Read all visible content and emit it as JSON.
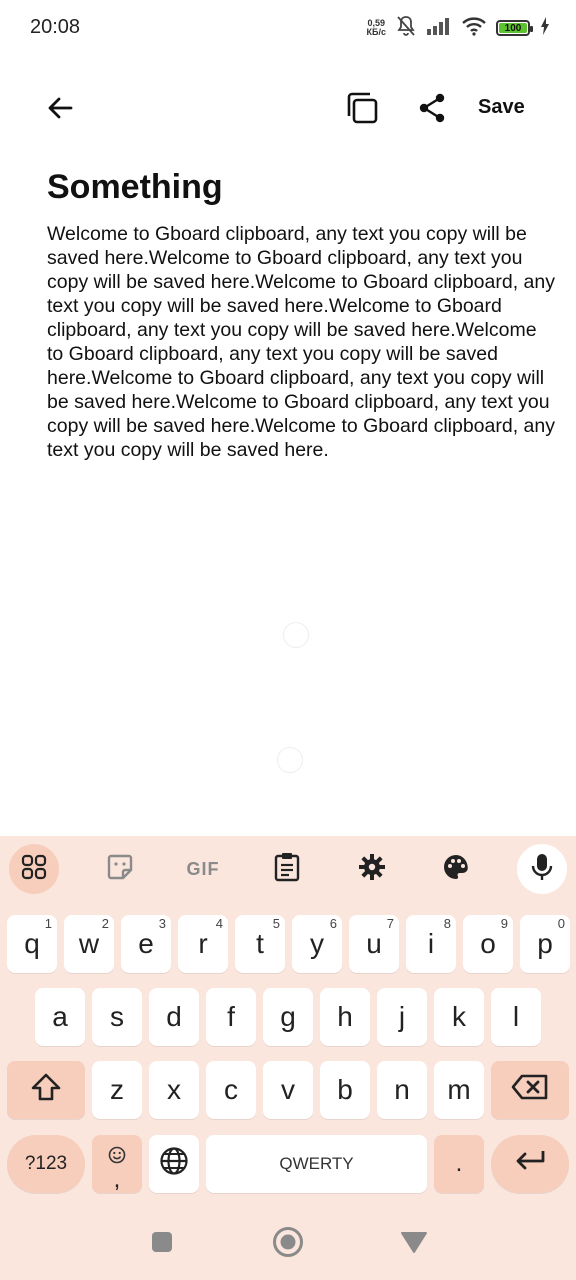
{
  "status_bar": {
    "time": "20:08",
    "net_speed_value": "0,59",
    "net_speed_unit": "КБ/с",
    "battery_level": "100",
    "icons": [
      "mute-icon",
      "signal-icon",
      "wifi-icon",
      "battery-icon",
      "charging-icon"
    ]
  },
  "app_bar": {
    "back_icon": "arrow-left-icon",
    "copy_icon": "copy-icon",
    "share_icon": "share-icon",
    "save_label": "Save"
  },
  "note": {
    "title": "Something",
    "body": "Welcome to Gboard clipboard, any text you copy will be saved here.Welcome to Gboard clipboard, any text you copy will be saved here.Welcome to Gboard clipboard, any text you copy will be saved here.Welcome to Gboard clipboard, any text you copy will be saved here.Welcome to Gboard clipboard, any text you copy will be saved here.Welcome to Gboard clipboard, any text you copy will be saved here.Welcome to Gboard clipboard, any text you copy will be saved here.Welcome to Gboard clipboard, any text you copy will be saved here."
  },
  "keyboard": {
    "toolbar": {
      "gif_label": "GIF",
      "icons": [
        "apps-grid-icon",
        "sticker-icon",
        "gif-icon",
        "clipboard-icon",
        "gear-icon",
        "palette-icon",
        "microphone-icon"
      ]
    },
    "row1": [
      {
        "label": "q",
        "hint": "1"
      },
      {
        "label": "w",
        "hint": "2"
      },
      {
        "label": "e",
        "hint": "3"
      },
      {
        "label": "r",
        "hint": "4"
      },
      {
        "label": "t",
        "hint": "5"
      },
      {
        "label": "y",
        "hint": "6"
      },
      {
        "label": "u",
        "hint": "7"
      },
      {
        "label": "i",
        "hint": "8"
      },
      {
        "label": "o",
        "hint": "9"
      },
      {
        "label": "p",
        "hint": "0"
      }
    ],
    "row2": [
      {
        "label": "a"
      },
      {
        "label": "s"
      },
      {
        "label": "d"
      },
      {
        "label": "f"
      },
      {
        "label": "g"
      },
      {
        "label": "h"
      },
      {
        "label": "j"
      },
      {
        "label": "k"
      },
      {
        "label": "l"
      }
    ],
    "row3": [
      {
        "label": "z"
      },
      {
        "label": "x"
      },
      {
        "label": "c"
      },
      {
        "label": "v"
      },
      {
        "label": "b"
      },
      {
        "label": "n"
      },
      {
        "label": "m"
      }
    ],
    "symbols_label": "?123",
    "comma_label": ",",
    "space_label": "QWERTY",
    "period_label": ".",
    "icons": [
      "shift-icon",
      "backspace-icon",
      "emoji-icon",
      "globe-icon",
      "enter-icon"
    ]
  },
  "nav_bar": {
    "icons": [
      "recents-square-icon",
      "home-circle-icon",
      "back-triangle-icon"
    ]
  }
}
